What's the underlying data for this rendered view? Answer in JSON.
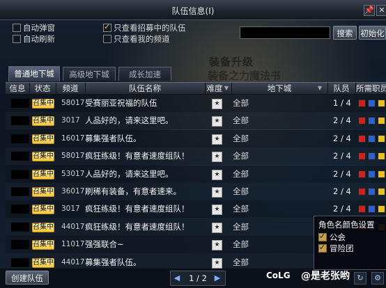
{
  "window": {
    "title": "队伍信息(I)"
  },
  "options": {
    "auto_popup": "自动弹窗",
    "auto_refresh": "自动刷新",
    "only_recruiting": "只查看招募中的队伍",
    "only_my_channel": "只查看我的频道"
  },
  "search": {
    "value": "",
    "button": "搜索",
    "reset": "初始化"
  },
  "tabs": [
    "普通地下城",
    "高级地下城",
    "成长加速"
  ],
  "background_text": {
    "line1": "装备升级",
    "line2": "装备之力魔法书"
  },
  "columns": [
    "信息",
    "状态",
    "频道",
    "队伍名称",
    "难度",
    "地下城",
    "队员",
    "所需职员"
  ],
  "rows": [
    {
      "status": "召集中",
      "channel": "58017",
      "name": "受赛丽亚祝福的队伍",
      "dungeon": "全部",
      "members": "1 / 4"
    },
    {
      "status": "召集中",
      "channel": "3017",
      "name": "人品好的，请来这里吧。",
      "dungeon": "全部",
      "members": "2 / 4"
    },
    {
      "status": "召集中",
      "channel": "16017",
      "name": "募集强者队伍。",
      "dungeon": "全部",
      "members": "2 / 4"
    },
    {
      "status": "召集中",
      "channel": "58017",
      "name": "疯狂练级！有意者速度组队！",
      "dungeon": "全部",
      "members": "2 / 4"
    },
    {
      "status": "召集中",
      "channel": "53017",
      "name": "人品好的，请来这里吧。",
      "dungeon": "全部",
      "members": "2 / 4"
    },
    {
      "status": "召集中",
      "channel": "36017",
      "name": "刷稀有装备，有意者速来。",
      "dungeon": "全部",
      "members": "2 / 4"
    },
    {
      "status": "召集中",
      "channel": "3017",
      "name": "疯狂练级！有意者速度组队！",
      "dungeon": "全部",
      "members": "2 / 4"
    },
    {
      "status": "召集中",
      "channel": "44017",
      "name": "疯狂练级！有意者速度组队！",
      "dungeon": "全部",
      "members": "2 / 4"
    },
    {
      "status": "召集中",
      "channel": "11017",
      "name": "强强联合~",
      "dungeon": "全部",
      "members": ""
    },
    {
      "status": "召集中",
      "channel": "44017",
      "name": "募集强者队伍。",
      "dungeon": "全部",
      "members": ""
    }
  ],
  "footer": {
    "create_button": "创建队伍",
    "page": "1 / 2"
  },
  "color_panel": {
    "title": "角色名颜色设置",
    "guild": "公会",
    "adventure": "冒险团"
  },
  "watermark": {
    "site": "CoLG",
    "user": "@是老张哟"
  },
  "colors": {
    "accent": "#f3c53a",
    "prof_red": "#d02020",
    "prof_blue": "#2a62d6",
    "prof_yellow": "#e8c020"
  }
}
